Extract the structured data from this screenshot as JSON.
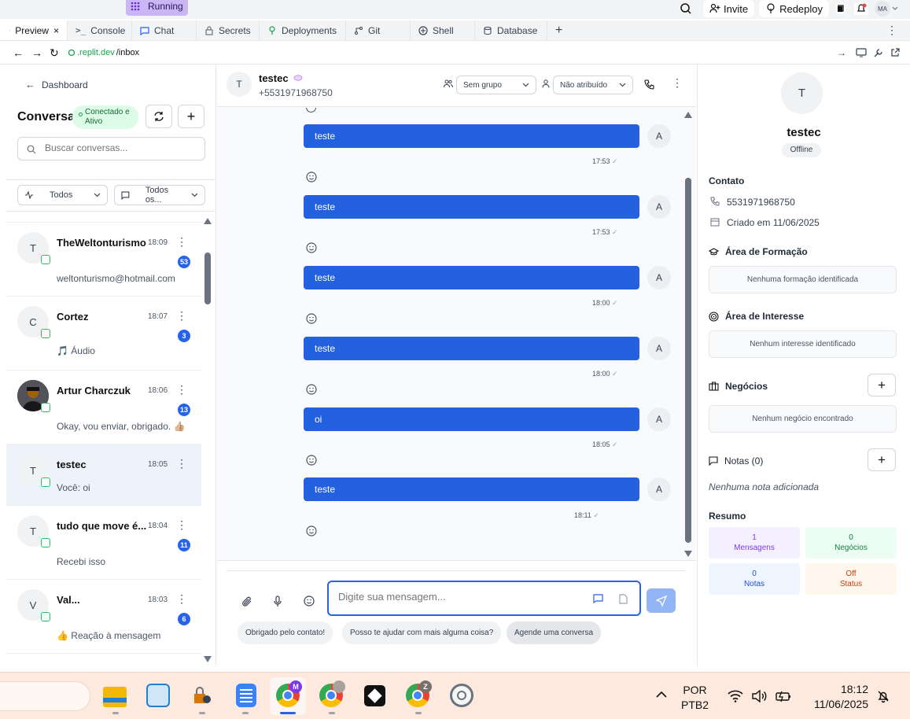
{
  "replit": {
    "status": "Running",
    "invite": "Invite",
    "redeploy": "Redeploy",
    "avatar_initials": "MA"
  },
  "tabs": [
    {
      "label": "Preview",
      "icon": "monitor-icon",
      "active": true
    },
    {
      "label": "Console",
      "icon": "terminal-icon"
    },
    {
      "label": "Chat",
      "icon": "chat-icon"
    },
    {
      "label": "Secrets",
      "icon": "lock-icon"
    },
    {
      "label": "Deployments",
      "icon": "deploy-icon"
    },
    {
      "label": "Git",
      "icon": "git-icon"
    },
    {
      "label": "Shell",
      "icon": "shell-icon"
    },
    {
      "label": "Database",
      "icon": "database-icon"
    }
  ],
  "url": {
    "domain": ".replit.dev",
    "path": "/inbox"
  },
  "sidebar": {
    "back_label": "Dashboard",
    "title": "Conversas",
    "status": "Conectado e Ativo",
    "search_placeholder": "Buscar conversas...",
    "filter1": "Todos",
    "filter2": "Todos os...",
    "conversations": [
      {
        "initial": "T",
        "name": "TheWeltonturismo",
        "time": "18:09",
        "count": "53",
        "preview": "weltonturismo@hotmail.com"
      },
      {
        "initial": "C",
        "name": "Cortez",
        "time": "18:07",
        "count": "3",
        "preview": "🎵 Áudio"
      },
      {
        "initial": "",
        "name": "Artur Charczuk",
        "time": "18:06",
        "count": "13",
        "preview": "Okay, vou enviar, obrigado. 👍🏼"
      },
      {
        "initial": "T",
        "name": "testec",
        "time": "18:05",
        "count": "",
        "preview": "Você: oi"
      },
      {
        "initial": "T",
        "name": "tudo que move é...",
        "time": "18:04",
        "count": "11",
        "preview": "Recebi isso"
      },
      {
        "initial": "V",
        "name": "Val...",
        "time": "18:03",
        "count": "6",
        "preview": "👍 Reação à mensagem"
      }
    ]
  },
  "chat": {
    "contact_initial": "T",
    "contact_name": "testec",
    "contact_phone": "+5531971968750",
    "group_select": "Sem grupo",
    "assign_select": "Não atribuído",
    "messages": [
      {
        "text": "teste",
        "time": "17:53",
        "avatar": "A"
      },
      {
        "text": "teste",
        "time": "17:53",
        "avatar": "A"
      },
      {
        "text": "teste",
        "time": "18:00",
        "avatar": "A"
      },
      {
        "text": "teste",
        "time": "18:00",
        "avatar": "A"
      },
      {
        "text": "oi",
        "time": "18:05",
        "avatar": "A"
      },
      {
        "text": "teste",
        "time": "18:11",
        "avatar": "A"
      }
    ],
    "input_placeholder": "Digite sua mensagem...",
    "quick_replies": [
      "Obrigado pelo contato!",
      "Posso te ajudar com mais alguma coisa?",
      "Agende uma conversa"
    ]
  },
  "details": {
    "initial": "T",
    "name": "testec",
    "status": "Offline",
    "contact_title": "Contato",
    "phone": "5531971968750",
    "created": "Criado em 11/06/2025",
    "formacao_title": "Área de Formação",
    "formacao_empty": "Nenhuma formação identificada",
    "interesse_title": "Área de Interesse",
    "interesse_empty": "Nenhum interesse identificado",
    "negocios_title": "Negócios",
    "negocios_empty": "Nenhum negócio encontrado",
    "notas_title": "Notas (0)",
    "notas_empty": "Nenhuma nota adicionada",
    "resumo_title": "Resumo",
    "stats": [
      {
        "value": "1",
        "label": "Mensagens",
        "bg": "#f5f0ff",
        "color": "#7c3aed"
      },
      {
        "value": "0",
        "label": "Negócios",
        "bg": "#ecfdf3",
        "color": "#15803d"
      },
      {
        "value": "0",
        "label": "Notas",
        "bg": "#eff6ff",
        "color": "#1d4ed8"
      },
      {
        "value": "Off",
        "label": "Status",
        "bg": "#fff7ed",
        "color": "#c2410c"
      }
    ]
  },
  "taskbar": {
    "lang1": "POR",
    "lang2": "PTB2",
    "time": "18:12",
    "date": "11/06/2025",
    "chrome_badges": [
      "M",
      "Z"
    ]
  },
  "colors": {
    "accent": "#2461e0",
    "online": "#22c55e"
  }
}
